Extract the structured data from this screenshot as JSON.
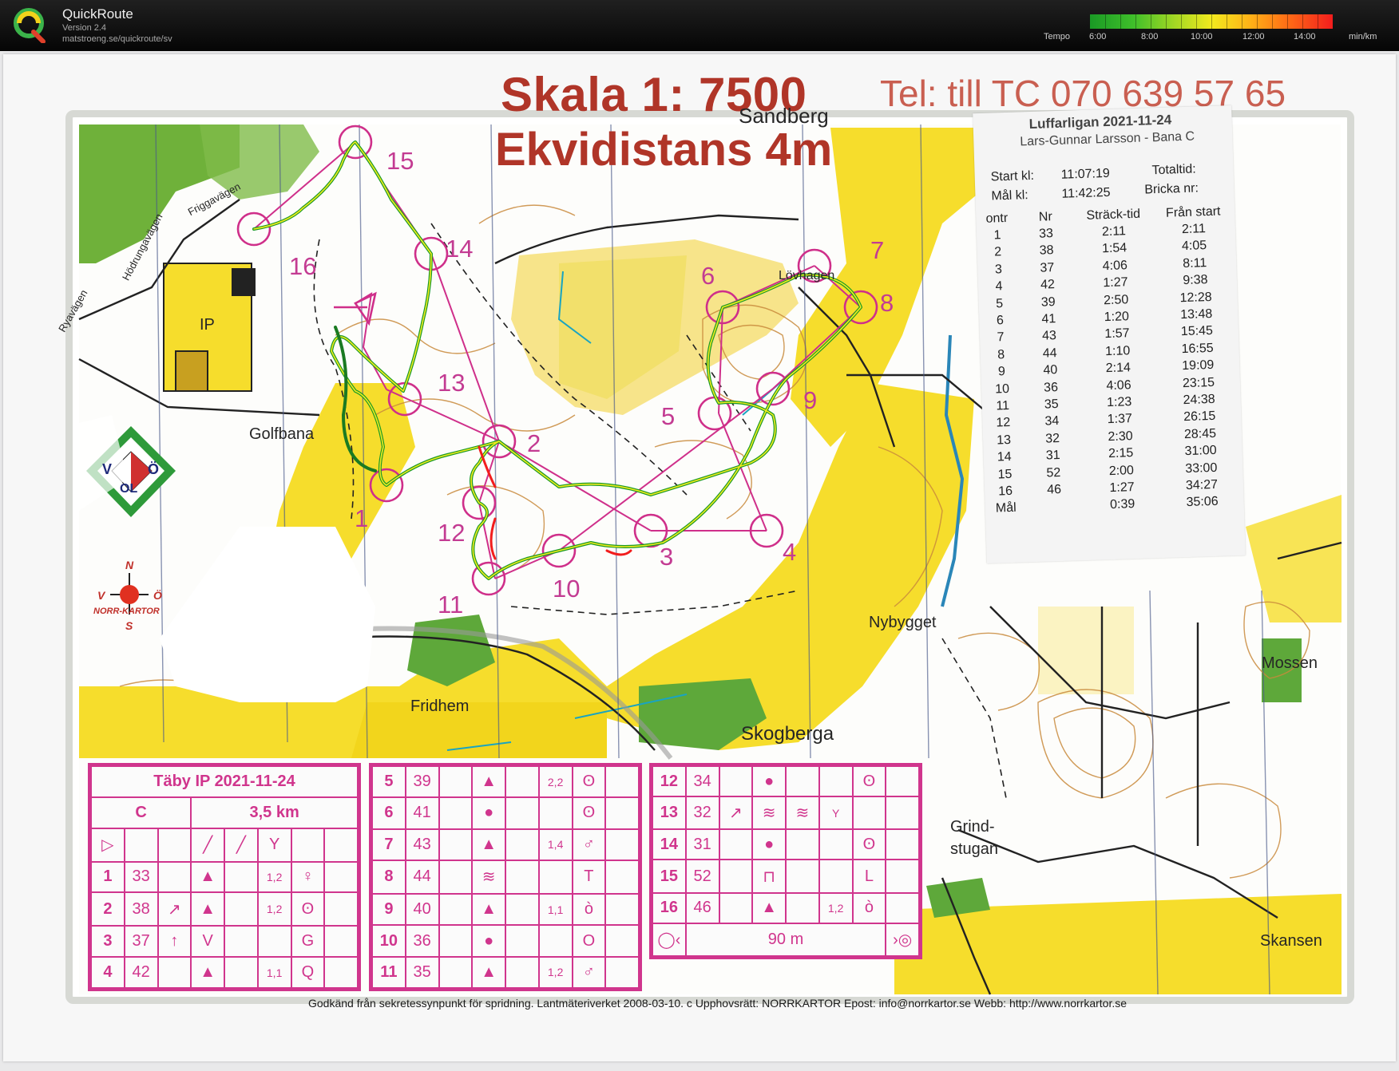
{
  "app": {
    "title": "QuickRoute",
    "version": "Version 2.4",
    "url": "matstroeng.se/quickroute/sv"
  },
  "pace_legend": {
    "label": "Tempo",
    "ticks": [
      "6:00",
      "8:00",
      "10:00",
      "12:00",
      "14:00"
    ],
    "unit": "min/km",
    "colors": [
      "#1a9a25",
      "#9ed624",
      "#f2ea1e",
      "#ffb217",
      "#f21d1d"
    ]
  },
  "map": {
    "scale_title": "Skala 1: 7500",
    "contour_title": "Ekvidistans 4m",
    "phone_text": "Tel: till TC 070 639 57 65",
    "controls": [
      "1",
      "2",
      "3",
      "4",
      "5",
      "6",
      "7",
      "8",
      "9",
      "10",
      "11",
      "12",
      "13",
      "14",
      "15",
      "16"
    ],
    "places": {
      "ip": "IP",
      "golfbana": "Golfbana",
      "lovhagen": "Lövhagen",
      "nybygget": "Nybygget",
      "fridhem": "Fridhem",
      "skogberga": "Skogberga",
      "mossen": "Mossen",
      "grindstugan": "Grind-\nstugan",
      "skansen": "Skansen",
      "sandberg": "Sandberg",
      "ryavagen": "Ryavägen",
      "friggavagen": "Friggavägen",
      "hodrungavagen": "Hödrungavägen"
    },
    "club_logo_letters": [
      "V",
      "Ö",
      "OL"
    ],
    "norrkartor": {
      "n": "N",
      "s": "S",
      "v": "V",
      "o": "Ö",
      "name": "NORR-KARTOR"
    },
    "footer": "Godkänd från sekretessynpunkt för spridning. Lantmäteriverket 2008-03-10.      c  Upphovsrätt: NORRKARTOR  Epost: info@norrkartor.se      Webb: http://www.norrkartor.se"
  },
  "result_slip": {
    "title": "Luffarligan 2021-11-24",
    "runner": "Lars-Gunnar Larsson - Bana C",
    "start_label": "Start kl:",
    "start_time": "11:07:19",
    "finish_label": "Mål kl:",
    "finish_time": "11:42:25",
    "total_label": "Totaltid:",
    "chip_label": "Bricka nr:",
    "columns": [
      "ontr",
      "Nr",
      "Sträck-tid",
      "Från start"
    ],
    "rows": [
      [
        "1",
        "33",
        "2:11",
        "2:11"
      ],
      [
        "2",
        "38",
        "1:54",
        "4:05"
      ],
      [
        "3",
        "37",
        "4:06",
        "8:11"
      ],
      [
        "4",
        "42",
        "1:27",
        "9:38"
      ],
      [
        "5",
        "39",
        "2:50",
        "12:28"
      ],
      [
        "6",
        "41",
        "1:20",
        "13:48"
      ],
      [
        "7",
        "43",
        "1:57",
        "15:45"
      ],
      [
        "8",
        "44",
        "1:10",
        "16:55"
      ],
      [
        "9",
        "40",
        "2:14",
        "19:09"
      ],
      [
        "10",
        "36",
        "4:06",
        "23:15"
      ],
      [
        "11",
        "35",
        "1:23",
        "24:38"
      ],
      [
        "12",
        "34",
        "1:37",
        "26:15"
      ],
      [
        "13",
        "32",
        "2:30",
        "28:45"
      ],
      [
        "14",
        "31",
        "2:15",
        "31:00"
      ],
      [
        "15",
        "52",
        "2:00",
        "33:00"
      ],
      [
        "16",
        "46",
        "1:27",
        "34:27"
      ],
      [
        "Mål",
        "",
        "0:39",
        "35:06"
      ]
    ]
  },
  "control_descriptions": {
    "title": "Täby IP 2021-11-24",
    "course": "C",
    "length": "3,5 km",
    "finish_distance": "90 m",
    "col1": [
      [
        "1",
        "33",
        "",
        "▲",
        "",
        "1,2",
        "♀"
      ],
      [
        "2",
        "38",
        "↗",
        "▲",
        "",
        "1,2",
        "ʘ"
      ],
      [
        "3",
        "37",
        "↑",
        "V",
        "",
        "",
        "G"
      ],
      [
        "4",
        "42",
        "",
        "▲",
        "",
        "1,1",
        "Q"
      ]
    ],
    "col2": [
      [
        "5",
        "39",
        "",
        "▲",
        "",
        "2,2",
        "ʘ"
      ],
      [
        "6",
        "41",
        "",
        "●",
        "",
        "",
        "ʘ"
      ],
      [
        "7",
        "43",
        "",
        "▲",
        "",
        "1,4",
        "♂"
      ],
      [
        "8",
        "44",
        "",
        "≋",
        "",
        "",
        "T"
      ],
      [
        "9",
        "40",
        "",
        "▲",
        "",
        "1,1",
        "ò"
      ],
      [
        "10",
        "36",
        "",
        "●",
        "",
        "",
        "O"
      ],
      [
        "11",
        "35",
        "",
        "▲",
        "",
        "1,2",
        "♂"
      ]
    ],
    "col3": [
      [
        "12",
        "34",
        "",
        "●",
        "",
        "",
        "ʘ"
      ],
      [
        "13",
        "32",
        "↗",
        "≋",
        "≋",
        "Y",
        ""
      ],
      [
        "14",
        "31",
        "",
        "●",
        "",
        "",
        "ʘ"
      ],
      [
        "15",
        "52",
        "",
        "⊓",
        "",
        "",
        "L"
      ],
      [
        "16",
        "46",
        "",
        "▲",
        "",
        "1,2",
        "ò"
      ]
    ]
  }
}
